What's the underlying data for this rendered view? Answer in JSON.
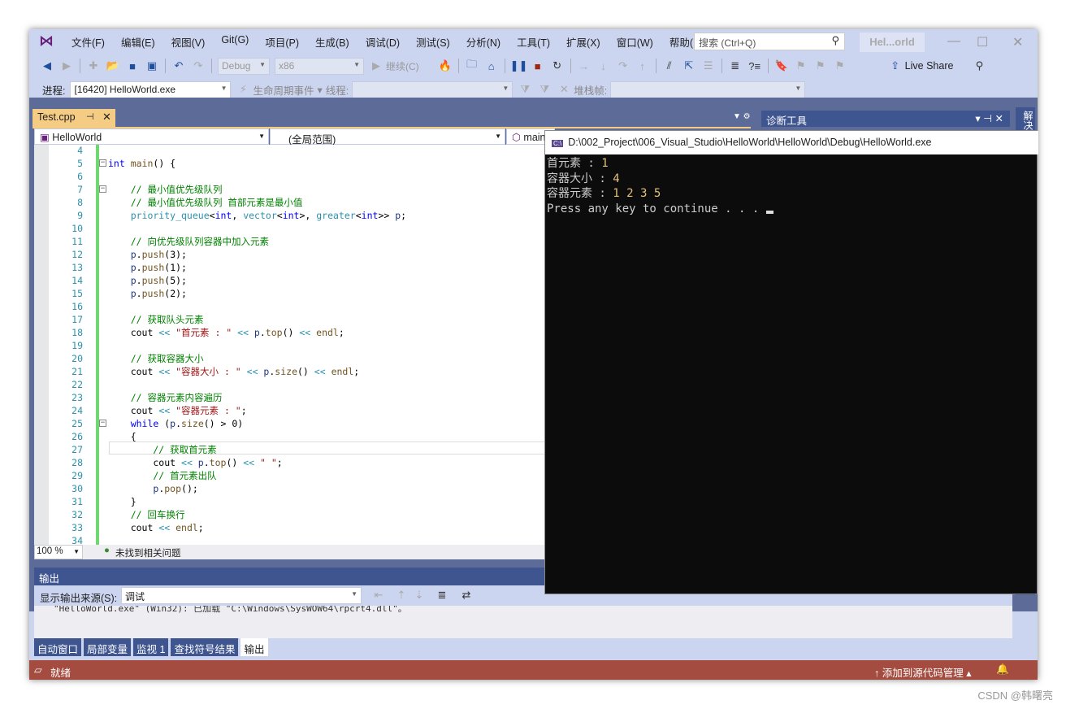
{
  "menu": {
    "items": [
      "文件(F)",
      "编辑(E)",
      "视图(V)",
      "Git(G)",
      "项目(P)",
      "生成(B)",
      "调试(D)",
      "测试(S)",
      "分析(N)",
      "工具(T)",
      "扩展(X)",
      "窗口(W)",
      "帮助(H)"
    ],
    "search_placeholder": "搜索 (Ctrl+Q)",
    "title": "Hel...orld"
  },
  "toolbar": {
    "config": "Debug",
    "platform": "x86",
    "continue": "继续(C)",
    "live_share": "Live Share"
  },
  "debugbar": {
    "process_label": "进程:",
    "process": "[16420] HelloWorld.exe",
    "lifecycle": "生命周期事件",
    "thread_label": "线程:",
    "stack_label": "堆栈帧:"
  },
  "editor": {
    "tab": "Test.cpp",
    "nav_project": "HelloWorld",
    "nav_scope": "(全局范围)",
    "nav_member": "main",
    "zoom": "100 %",
    "issues": "未找到相关问题",
    "lines": [
      {
        "n": 4,
        "t": []
      },
      {
        "n": 5,
        "t": [
          [
            "int",
            "kw"
          ],
          [
            " main",
            "fn"
          ],
          [
            "() {",
            "pl"
          ]
        ],
        "fold": true,
        "indent": 0
      },
      {
        "n": 6,
        "t": []
      },
      {
        "n": 7,
        "t": [
          [
            "    // 最小值优先级队列",
            "cmt"
          ]
        ],
        "fold": true
      },
      {
        "n": 8,
        "t": [
          [
            "    // 最小值优先级队列 首部元素是最小值",
            "cmt"
          ]
        ]
      },
      {
        "n": 9,
        "t": [
          [
            "    priority_queue",
            "type"
          ],
          [
            "<",
            "pl"
          ],
          [
            "int",
            "kw"
          ],
          [
            ", ",
            "pl"
          ],
          [
            "vector",
            "type"
          ],
          [
            "<",
            "pl"
          ],
          [
            "int",
            "kw"
          ],
          [
            ">, ",
            "pl"
          ],
          [
            "greater",
            "type"
          ],
          [
            "<",
            "pl"
          ],
          [
            "int",
            "kw"
          ],
          [
            ">> ",
            "pl"
          ],
          [
            "p",
            "var"
          ],
          [
            ";",
            "pl"
          ]
        ]
      },
      {
        "n": 10,
        "t": []
      },
      {
        "n": 11,
        "t": [
          [
            "    // 向优先级队列容器中加入元素",
            "cmt"
          ]
        ]
      },
      {
        "n": 12,
        "t": [
          [
            "    p",
            "var"
          ],
          [
            ".",
            "pl"
          ],
          [
            "push",
            "fn"
          ],
          [
            "(3);",
            "pl"
          ]
        ]
      },
      {
        "n": 13,
        "t": [
          [
            "    p",
            "var"
          ],
          [
            ".",
            "pl"
          ],
          [
            "push",
            "fn"
          ],
          [
            "(1);",
            "pl"
          ]
        ]
      },
      {
        "n": 14,
        "t": [
          [
            "    p",
            "var"
          ],
          [
            ".",
            "pl"
          ],
          [
            "push",
            "fn"
          ],
          [
            "(5);",
            "pl"
          ]
        ]
      },
      {
        "n": 15,
        "t": [
          [
            "    p",
            "var"
          ],
          [
            ".",
            "pl"
          ],
          [
            "push",
            "fn"
          ],
          [
            "(2);",
            "pl"
          ]
        ]
      },
      {
        "n": 16,
        "t": []
      },
      {
        "n": 17,
        "t": [
          [
            "    // 获取队头元素",
            "cmt"
          ]
        ]
      },
      {
        "n": 18,
        "t": [
          [
            "    cout ",
            "pl"
          ],
          [
            "<<",
            "type"
          ],
          [
            " \"首元素 : \" ",
            "str"
          ],
          [
            "<<",
            "type"
          ],
          [
            " p",
            "var"
          ],
          [
            ".",
            "pl"
          ],
          [
            "top",
            "fn"
          ],
          [
            "() ",
            "pl"
          ],
          [
            "<<",
            "type"
          ],
          [
            " endl",
            "fn"
          ],
          [
            ";",
            "pl"
          ]
        ]
      },
      {
        "n": 19,
        "t": []
      },
      {
        "n": 20,
        "t": [
          [
            "    // 获取容器大小",
            "cmt"
          ]
        ]
      },
      {
        "n": 21,
        "t": [
          [
            "    cout ",
            "pl"
          ],
          [
            "<<",
            "type"
          ],
          [
            " \"容器大小 : \" ",
            "str"
          ],
          [
            "<<",
            "type"
          ],
          [
            " p",
            "var"
          ],
          [
            ".",
            "pl"
          ],
          [
            "size",
            "fn"
          ],
          [
            "() ",
            "pl"
          ],
          [
            "<<",
            "type"
          ],
          [
            " endl",
            "fn"
          ],
          [
            ";",
            "pl"
          ]
        ]
      },
      {
        "n": 22,
        "t": []
      },
      {
        "n": 23,
        "t": [
          [
            "    // 容器元素内容遍历",
            "cmt"
          ]
        ]
      },
      {
        "n": 24,
        "t": [
          [
            "    cout ",
            "pl"
          ],
          [
            "<<",
            "type"
          ],
          [
            " \"容器元素 : \"",
            "str"
          ],
          [
            ";",
            "pl"
          ]
        ]
      },
      {
        "n": 25,
        "t": [
          [
            "    while",
            "kw"
          ],
          [
            " (",
            "pl"
          ],
          [
            "p",
            "var"
          ],
          [
            ".",
            "pl"
          ],
          [
            "size",
            "fn"
          ],
          [
            "() > 0)",
            "pl"
          ]
        ],
        "fold": true
      },
      {
        "n": 26,
        "t": [
          [
            "    {",
            "pl"
          ]
        ]
      },
      {
        "n": 27,
        "t": [
          [
            "        // 获取首元素",
            "cmt"
          ]
        ]
      },
      {
        "n": 28,
        "t": [
          [
            "        cout ",
            "pl"
          ],
          [
            "<<",
            "type"
          ],
          [
            " p",
            "var"
          ],
          [
            ".",
            "pl"
          ],
          [
            "top",
            "fn"
          ],
          [
            "() ",
            "pl"
          ],
          [
            "<<",
            "type"
          ],
          [
            " \" \"",
            "str"
          ],
          [
            ";",
            "pl"
          ]
        ]
      },
      {
        "n": 29,
        "t": [
          [
            "        // 首元素出队",
            "cmt"
          ]
        ]
      },
      {
        "n": 30,
        "t": [
          [
            "        p",
            "var"
          ],
          [
            ".",
            "pl"
          ],
          [
            "pop",
            "fn"
          ],
          [
            "();",
            "pl"
          ]
        ]
      },
      {
        "n": 31,
        "t": [
          [
            "    }",
            "pl"
          ]
        ]
      },
      {
        "n": 32,
        "t": [
          [
            "    // 回车换行",
            "cmt"
          ]
        ]
      },
      {
        "n": 33,
        "t": [
          [
            "    cout ",
            "pl"
          ],
          [
            "<<",
            "type"
          ],
          [
            " endl",
            "fn"
          ],
          [
            ";",
            "pl"
          ]
        ]
      },
      {
        "n": 34,
        "t": []
      }
    ]
  },
  "diag": {
    "title": "诊断工具",
    "side_label": "解决"
  },
  "console": {
    "title": "D:\\002_Project\\006_Visual_Studio\\HelloWorld\\HelloWorld\\Debug\\HelloWorld.exe",
    "lines": [
      {
        "a": "首元素 : ",
        "b": "1"
      },
      {
        "a": "容器大小 : ",
        "b": "4"
      },
      {
        "a": "容器元素 : ",
        "b": "1 2 3 5"
      },
      {
        "a": "Press any key to continue . . . ",
        "b": ""
      }
    ]
  },
  "output": {
    "title": "输出",
    "source_label": "显示输出来源(S):",
    "source": "调试",
    "text": "\"HelloWorld.exe\" (Win32): 已加载 \"C:\\Windows\\SysWOW64\\rpcrt4.dll\"。"
  },
  "bottom_tabs": [
    {
      "label": "自动窗口"
    },
    {
      "label": "局部变量"
    },
    {
      "label": "监视 1"
    },
    {
      "label": "查找符号结果"
    },
    {
      "label": "输出",
      "active": true
    }
  ],
  "status": {
    "text": "就绪",
    "source_control": "添加到源代码管理",
    "color": "#a44c40"
  },
  "watermark": "CSDN @韩曙亮"
}
